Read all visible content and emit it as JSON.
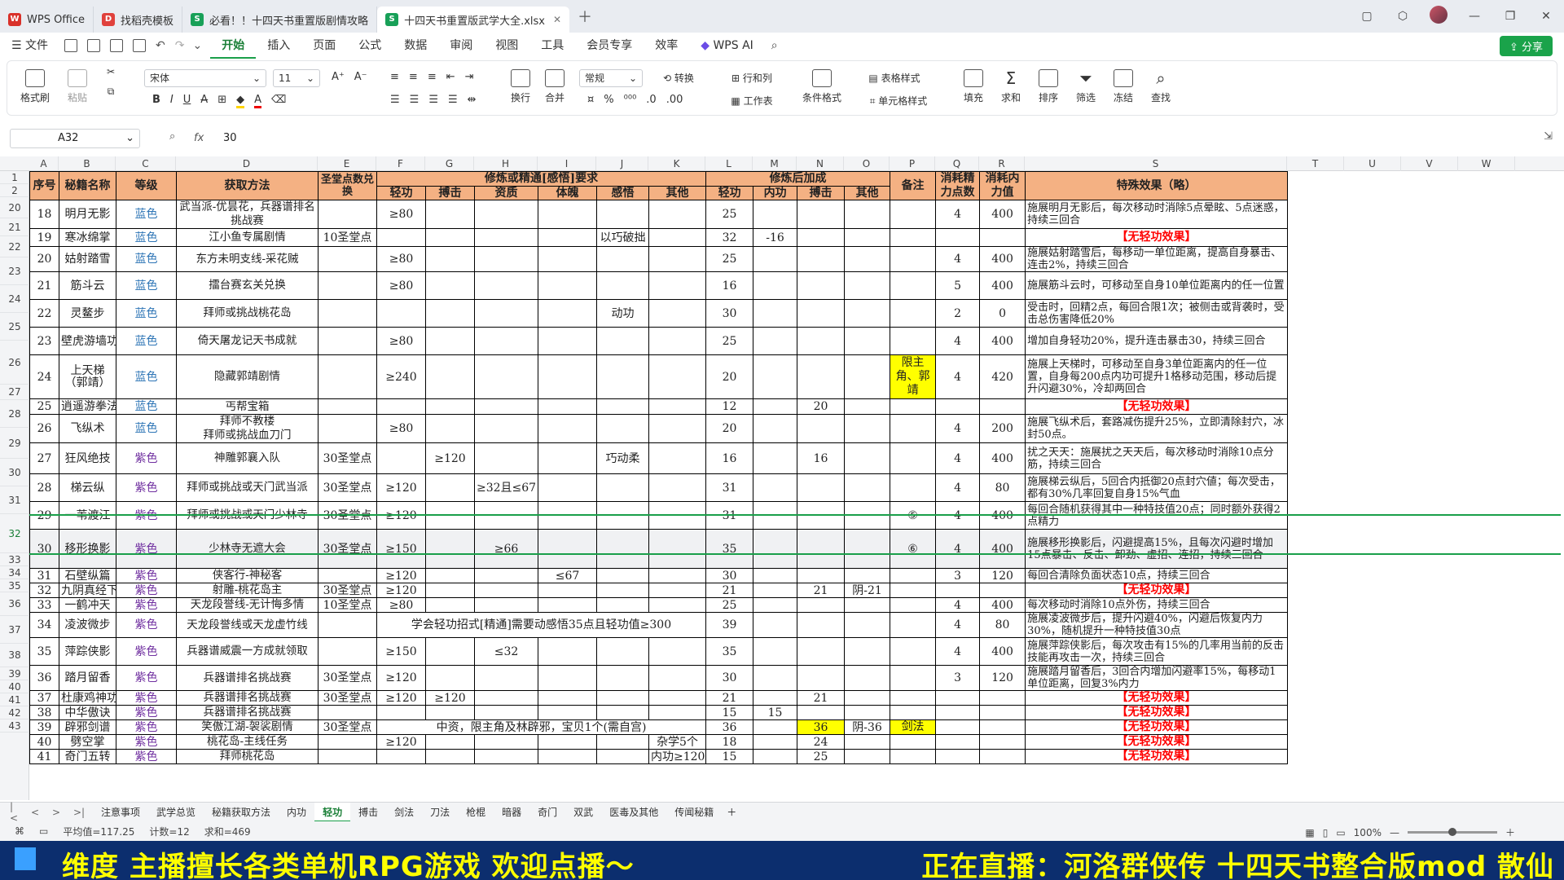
{
  "window": {
    "tabs": [
      {
        "label": "WPS Office",
        "color": "#d9312a",
        "glyph": "W"
      },
      {
        "label": "找稻壳模板",
        "color": "#e0413c",
        "glyph": "D"
      },
      {
        "label": "必看！！十四天书重置版剧情攻略",
        "color": "#18a058",
        "glyph": "S"
      },
      {
        "label": "十四天书重置版武学大全.xlsx",
        "color": "#18a058",
        "glyph": "S"
      }
    ]
  },
  "menu": {
    "file": "文件",
    "items": [
      "开始",
      "插入",
      "页面",
      "公式",
      "数据",
      "审阅",
      "视图",
      "工具",
      "会员专享",
      "效率"
    ],
    "ai": "WPS AI",
    "share": "分享"
  },
  "ribbon": {
    "format_painter": "格式刷",
    "paste": "粘贴",
    "font_name": "宋体",
    "font_size": "11",
    "wrap": "换行",
    "merge": "合并",
    "number_format": "常规",
    "convert": "转换",
    "row_col": "行和列",
    "worksheet": "工作表",
    "cond_format": "条件格式",
    "table_style": "表格样式",
    "cell_style": "单元格样式",
    "fill": "填充",
    "sum": "求和",
    "sort": "排序",
    "filter": "筛选",
    "freeze": "冻结",
    "find": "查找"
  },
  "formula": {
    "cell": "A32",
    "fx": "fx",
    "value": "30"
  },
  "columns": [
    "A",
    "B",
    "C",
    "D",
    "E",
    "F",
    "G",
    "H",
    "I",
    "J",
    "K",
    "L",
    "M",
    "N",
    "O",
    "P",
    "Q",
    "R",
    "S",
    "T",
    "U",
    "V",
    "W"
  ],
  "header": {
    "r1": [
      "序号",
      "秘籍名称",
      "等级",
      "获取方法",
      "圣堂点数兑换",
      "修炼或精通[感悟]要求",
      "修炼后加成",
      "备注",
      "消耗精力点数",
      "消耗内力值",
      "特殊效果（略）"
    ],
    "r2": [
      "轻功",
      "搏击",
      "资质",
      "体魄",
      "感悟",
      "其他",
      "轻功",
      "内功",
      "搏击",
      "其他"
    ]
  },
  "rows": [
    {
      "rn": "20",
      "c": [
        "18",
        "明月无影",
        "蓝色",
        "武当派-优昙花，兵器谱排名挑战赛",
        "",
        "≥80",
        "",
        "",
        "",
        "",
        "",
        "25",
        "",
        "",
        "",
        "",
        "4",
        "400",
        "施展明月无影后，每次移动时消除5点晕眩、5点迷惑，持续三回合"
      ]
    },
    {
      "rn": "21",
      "c": [
        "19",
        "寒冰绵掌",
        "蓝色",
        "江小鱼专属剧情",
        "10圣堂点",
        "",
        "",
        "",
        "",
        "以巧破拙",
        "",
        "32",
        "-16",
        "",
        "",
        "",
        "",
        "",
        "【无轻功效果】"
      ]
    },
    {
      "rn": "22",
      "c": [
        "20",
        "姑射踏雪",
        "蓝色",
        "东方未明支线-采花贼",
        "",
        "≥80",
        "",
        "",
        "",
        "",
        "",
        "25",
        "",
        "",
        "",
        "",
        "4",
        "400",
        "施展姑射踏雪后，每移动一单位距离，提高自身暴击、连击2%，持续三回合"
      ]
    },
    {
      "rn": "23",
      "c": [
        "21",
        "筋斗云",
        "蓝色",
        "擂台赛玄关兑换",
        "",
        "≥80",
        "",
        "",
        "",
        "",
        "",
        "16",
        "",
        "",
        "",
        "",
        "5",
        "400",
        "施展筋斗云时，可移动至自身10单位距离内的任一位置"
      ]
    },
    {
      "rn": "24",
      "c": [
        "22",
        "灵鳌步",
        "蓝色",
        "拜师或挑战桃花岛",
        "",
        "",
        "",
        "",
        "",
        "动功",
        "",
        "30",
        "",
        "",
        "",
        "",
        "2",
        "0",
        "受击时，回精2点，每回合限1次；被侧击或背袭时，受击总伤害降低20%"
      ]
    },
    {
      "rn": "25",
      "c": [
        "23",
        "壁虎游墙功",
        "蓝色",
        "倚天屠龙记天书成就",
        "",
        "≥80",
        "",
        "",
        "",
        "",
        "",
        "25",
        "",
        "",
        "",
        "",
        "4",
        "400",
        "增加自身轻功20%，提升连击暴击30，持续三回合"
      ]
    },
    {
      "rn": "26",
      "c": [
        "24",
        "上天梯（郭靖）",
        "蓝色",
        "隐藏郭靖剧情",
        "",
        "≥240",
        "",
        "",
        "",
        "",
        "",
        "20",
        "",
        "",
        "",
        "限主角、郭靖",
        "4",
        "420",
        "施展上天梯时，可移动至自身3单位距离内的任一位置，自身每200点内功可提升1格移动范围，移动后提升闪避30%，冷却两回合"
      ]
    },
    {
      "rn": "27",
      "c": [
        "25",
        "逍遥游拳法",
        "蓝色",
        "丐帮宝箱",
        "",
        "",
        "",
        "",
        "",
        "",
        "",
        "12",
        "",
        "20",
        "",
        "",
        "",
        "",
        "【无轻功效果】"
      ]
    },
    {
      "rn": "28",
      "c": [
        "26",
        "飞纵术",
        "蓝色",
        "拜师不教楼\n拜师或挑战血刀门",
        "",
        "≥80",
        "",
        "",
        "",
        "",
        "",
        "20",
        "",
        "",
        "",
        "",
        "4",
        "200",
        "施展飞纵术后，套路减伤提升25%，立即清除封穴，冰封50点。"
      ]
    },
    {
      "rn": "29",
      "c": [
        "27",
        "狂风绝技",
        "紫色",
        "神雕郭襄入队",
        "30圣堂点",
        "",
        "≥120",
        "",
        "",
        "巧动柔",
        "",
        "16",
        "",
        "16",
        "",
        "",
        "4",
        "400",
        "扰之天天：施展扰之天天后，每次移动时消除10点分筋，持续三回合"
      ]
    },
    {
      "rn": "30",
      "c": [
        "28",
        "梯云纵",
        "紫色",
        "拜师或挑战或天门武当派",
        "30圣堂点",
        "≥120",
        "",
        "≥32且≤67",
        "",
        "",
        "",
        "31",
        "",
        "",
        "",
        "",
        "4",
        "80",
        "施展梯云纵后，5回合内抵御20点封穴値；每次受击，都有30%几率回复自身15%气血"
      ]
    },
    {
      "rn": "31",
      "c": [
        "29",
        "一苇渡江",
        "紫色",
        "拜师或挑战或天门少林寺",
        "30圣堂点",
        "≥120",
        "",
        "",
        "",
        "",
        "",
        "31",
        "",
        "",
        "",
        "⑤",
        "4",
        "400",
        "每回合随机获得其中一种特技值20点；同时额外获得2点精力"
      ]
    },
    {
      "rn": "32",
      "c": [
        "30",
        "移形换影",
        "紫色",
        "少林寺无遮大会",
        "30圣堂点",
        "≥150",
        "",
        "≥66",
        "",
        "",
        "",
        "35",
        "",
        "",
        "",
        "⑥",
        "4",
        "400",
        "施展移形换影后，闪避提高15%，且每次闪避时增加15点暴击、反击、卸劲、虚招、连招，持续三回合"
      ],
      "sel": true
    },
    {
      "rn": "33",
      "c": [
        "31",
        "石壁纵篇",
        "紫色",
        "侠客行-神秘客",
        "",
        "≥120",
        "",
        "",
        "≤67",
        "",
        "",
        "30",
        "",
        "",
        "",
        "",
        "3",
        "120",
        "每回合清除负面状态10点，持续三回合"
      ]
    },
    {
      "rn": "34",
      "c": [
        "32",
        "九阴真经下",
        "紫色",
        "射雕-桃花岛主",
        "30圣堂点",
        "≥120",
        "",
        "",
        "",
        "",
        "",
        "21",
        "",
        "21",
        "阴-21",
        "",
        "",
        "",
        "【无轻功效果】"
      ]
    },
    {
      "rn": "35",
      "c": [
        "33",
        "一鹤冲天",
        "紫色",
        "天龙段誉线-无计悔多情",
        "10圣堂点",
        "≥80",
        "",
        "",
        "",
        "",
        "",
        "25",
        "",
        "",
        "",
        "",
        "4",
        "400",
        "每次移动时消除10点外伤，持续三回合"
      ]
    },
    {
      "rn": "36",
      "c": [
        "34",
        "凌波微步",
        "紫色",
        "天龙段誉线或天龙虚竹线",
        "",
        "学会轻功招式[精通]需要动感悟35点且轻功值≥300",
        "",
        "",
        "",
        "",
        "",
        "39",
        "",
        "",
        "",
        "",
        "4",
        "80",
        "施展凌波微步后，提升闪避40%，闪避后恢复内力30%，随机提升一种特技值30点"
      ]
    },
    {
      "rn": "37",
      "c": [
        "35",
        "萍踪侠影",
        "紫色",
        "兵器谱威震一方成就领取",
        "",
        "≥150",
        "",
        "≤32",
        "",
        "",
        "",
        "35",
        "",
        "",
        "",
        "",
        "4",
        "400",
        "施展萍踪侠影后，每次攻击有15%的几率用当前的反击技能再攻击一次，持续三回合"
      ]
    },
    {
      "rn": "38",
      "c": [
        "36",
        "踏月留香",
        "紫色",
        "兵器谱排名挑战赛",
        "30圣堂点",
        "≥120",
        "",
        "",
        "",
        "",
        "",
        "30",
        "",
        "",
        "",
        "",
        "3",
        "120",
        "施展踏月留香后，3回合内增加闪避率15%，每移动1单位距离，回复3%内力"
      ]
    },
    {
      "rn": "39",
      "c": [
        "37",
        "杜康鸡神功",
        "紫色",
        "兵器谱排名挑战赛",
        "30圣堂点",
        "≥120",
        "≥120",
        "",
        "",
        "",
        "",
        "21",
        "",
        "21",
        "",
        "",
        "",
        "",
        "【无轻功效果】"
      ]
    },
    {
      "rn": "40",
      "c": [
        "38",
        "中华傲诀",
        "紫色",
        "兵器谱排名挑战赛",
        "",
        "",
        "",
        "",
        "",
        "",
        "",
        "15",
        "15",
        "",
        "",
        "",
        "",
        "",
        "【无轻功效果】"
      ]
    },
    {
      "rn": "41",
      "c": [
        "39",
        "辟邪剑谱",
        "紫色",
        "笑傲江湖-袈裟剧情",
        "30圣堂点",
        "中资，限主角及林辟邪，宝贝1个(需自宫)",
        "",
        "",
        "",
        "",
        "",
        "36",
        "",
        "36",
        "阴-36",
        "剑法",
        "",
        "",
        "【无轻功效果】"
      ]
    },
    {
      "rn": "42",
      "c": [
        "40",
        "劈空掌",
        "紫色",
        "桃花岛-主线任务",
        "",
        "≥120",
        "",
        "",
        "",
        "",
        "杂学5个",
        "18",
        "",
        "24",
        "",
        "",
        "",
        "",
        "【无轻功效果】"
      ]
    },
    {
      "rn": "43",
      "c": [
        "41",
        "奇门五转",
        "紫色",
        "拜师桃花岛",
        "",
        "",
        "",
        "",
        "",
        "",
        "内功≥120",
        "15",
        "",
        "25",
        "",
        "",
        "",
        "",
        "【无轻功效果】"
      ]
    }
  ],
  "sheet_tabs": [
    "注意事项",
    "武学总览",
    "秘籍获取方法",
    "内功",
    "轻功",
    "搏击",
    "剑法",
    "刀法",
    "枪棍",
    "暗器",
    "奇门",
    "双武",
    "医毒及其他",
    "传闻秘籍"
  ],
  "active_tab": "轻功",
  "status": {
    "avg": "平均值=117.25",
    "count": "计数=12",
    "sum": "求和=469",
    "zoom": "100%"
  },
  "banner": {
    "left": "维度 主播擅长各类单机RPG游戏 欢迎点播～",
    "right": "正在直播：河洛群侠传 十四天书整合版mod 散仙"
  },
  "colors": {
    "header": "#f4b183",
    "accent": "#1a9f4a",
    "blue_grade": "#2e75b6",
    "purple_grade": "#7030a0",
    "red_text": "#ff0000",
    "highlight": "#ffff00"
  }
}
